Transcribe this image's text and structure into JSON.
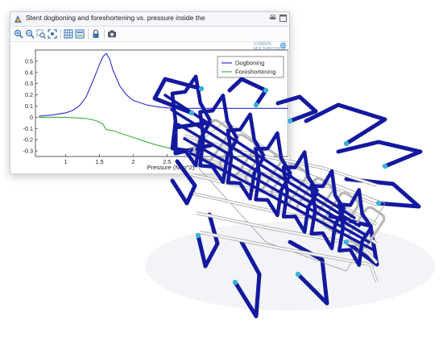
{
  "window": {
    "title": "Stent dogboning and foreshortening vs. pressure inside the",
    "close_glyph": "⊠",
    "brand_line1": "COMSOL",
    "brand_line2": "MULTIPHYSICS"
  },
  "toolbar": {
    "buttons": [
      "zoom-in-icon",
      "zoom-out-icon",
      "zoom-box-icon",
      "zoom-extents-icon",
      "show-grid-icon",
      "show-legend-icon",
      "lock-axis-icon",
      "image-snapshot-icon"
    ]
  },
  "colors": {
    "dogboning": "#2b2bd6",
    "foreshortening": "#3cb043",
    "stent_blue": "#13199e",
    "stent_hot": "#38b4d8",
    "stent_gray": "#b8b8b8"
  },
  "chart_data": {
    "type": "line",
    "title": "",
    "xlabel": "Pressure (N/m^2)",
    "ylabel": "",
    "xlim": [
      0.55,
      4.3
    ],
    "ylim": [
      -0.35,
      0.6
    ],
    "xticks": [
      "1",
      "1.5",
      "2",
      "2.5"
    ],
    "yticks": [
      "0.5",
      "0.4",
      "0.3",
      "0.2",
      "0.1",
      "0",
      "-0.1",
      "-0.2",
      "-0.3"
    ],
    "grid": false,
    "legend_position": "top-right",
    "series": [
      {
        "name": "Dogboning",
        "x": [
          0.6,
          0.8,
          1.0,
          1.1,
          1.2,
          1.3,
          1.4,
          1.5,
          1.55,
          1.6,
          1.65,
          1.7,
          1.8,
          1.9,
          2.0,
          2.2,
          2.4,
          2.6,
          3.0,
          3.5,
          4.3
        ],
        "values": [
          0.01,
          0.02,
          0.04,
          0.06,
          0.1,
          0.18,
          0.32,
          0.47,
          0.54,
          0.57,
          0.52,
          0.42,
          0.28,
          0.2,
          0.15,
          0.11,
          0.09,
          0.08,
          0.08,
          0.08,
          0.08
        ]
      },
      {
        "name": "Foreshortening",
        "x": [
          0.6,
          1.0,
          1.3,
          1.45,
          1.55,
          1.6,
          1.7,
          1.9,
          2.1,
          2.3,
          2.5,
          2.7,
          3.0
        ],
        "values": [
          0.0,
          0.0,
          -0.01,
          -0.03,
          -0.06,
          -0.11,
          -0.12,
          -0.16,
          -0.2,
          -0.24,
          -0.27,
          -0.29,
          -0.3
        ]
      }
    ]
  }
}
